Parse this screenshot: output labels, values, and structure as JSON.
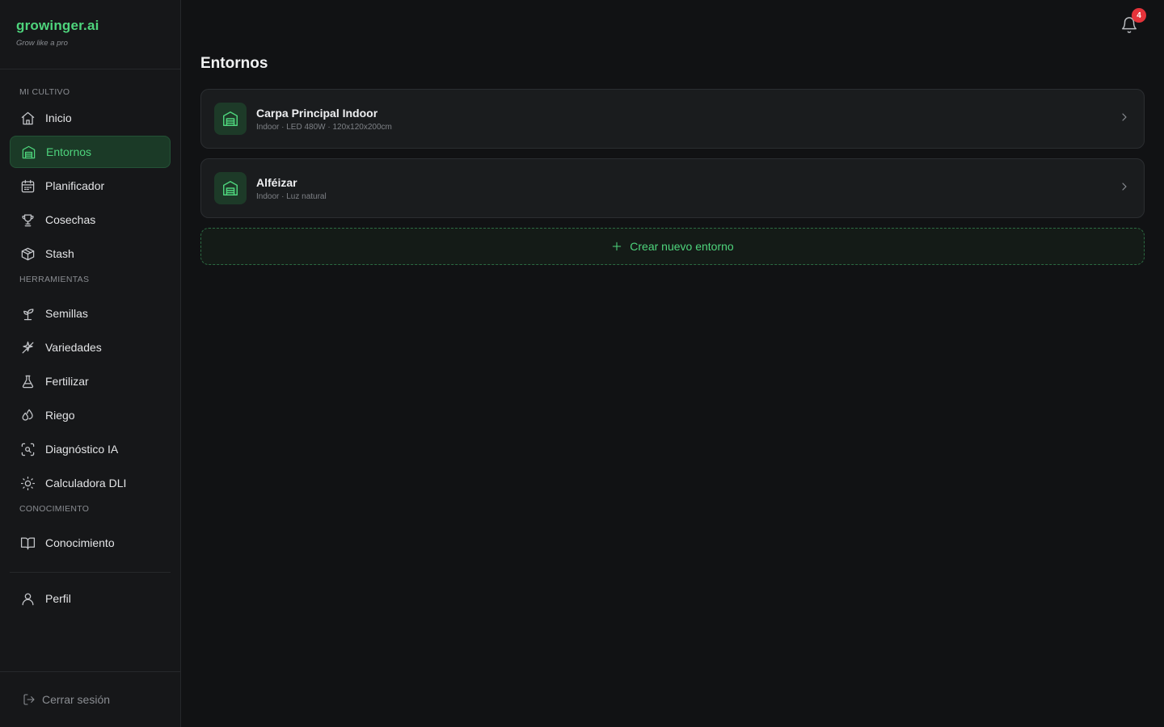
{
  "brand": {
    "name": "growinger.ai",
    "tagline": "Grow like a pro"
  },
  "sidebar": {
    "sections": {
      "mi_cultivo": "MI CULTIVO",
      "herramientas": "HERRAMIENTAS",
      "conocimiento": "CONOCIMIENTO"
    },
    "items": {
      "inicio": "Inicio",
      "entornos": "Entornos",
      "planificador": "Planificador",
      "cosechas": "Cosechas",
      "stash": "Stash",
      "semillas": "Semillas",
      "variedades": "Variedades",
      "fertilizar": "Fertilizar",
      "riego": "Riego",
      "diagnostico": "Diagnóstico IA",
      "calculadora": "Calculadora DLI",
      "conocimiento": "Conocimiento",
      "perfil": "Perfil"
    },
    "active": "entornos",
    "logout": "Cerrar sesión"
  },
  "header": {
    "notifications_count": "4"
  },
  "main": {
    "title": "Entornos",
    "environments": [
      {
        "name": "Carpa Principal Indoor",
        "meta": "Indoor · LED 480W · 120x120x200cm"
      },
      {
        "name": "Alféizar",
        "meta": "Indoor · Luz natural"
      }
    ],
    "create_label": "Crear nuevo entorno"
  },
  "colors": {
    "accent": "#4ed47c",
    "background": "#111214",
    "sidebar": "#161719",
    "badge": "#e5333a"
  }
}
